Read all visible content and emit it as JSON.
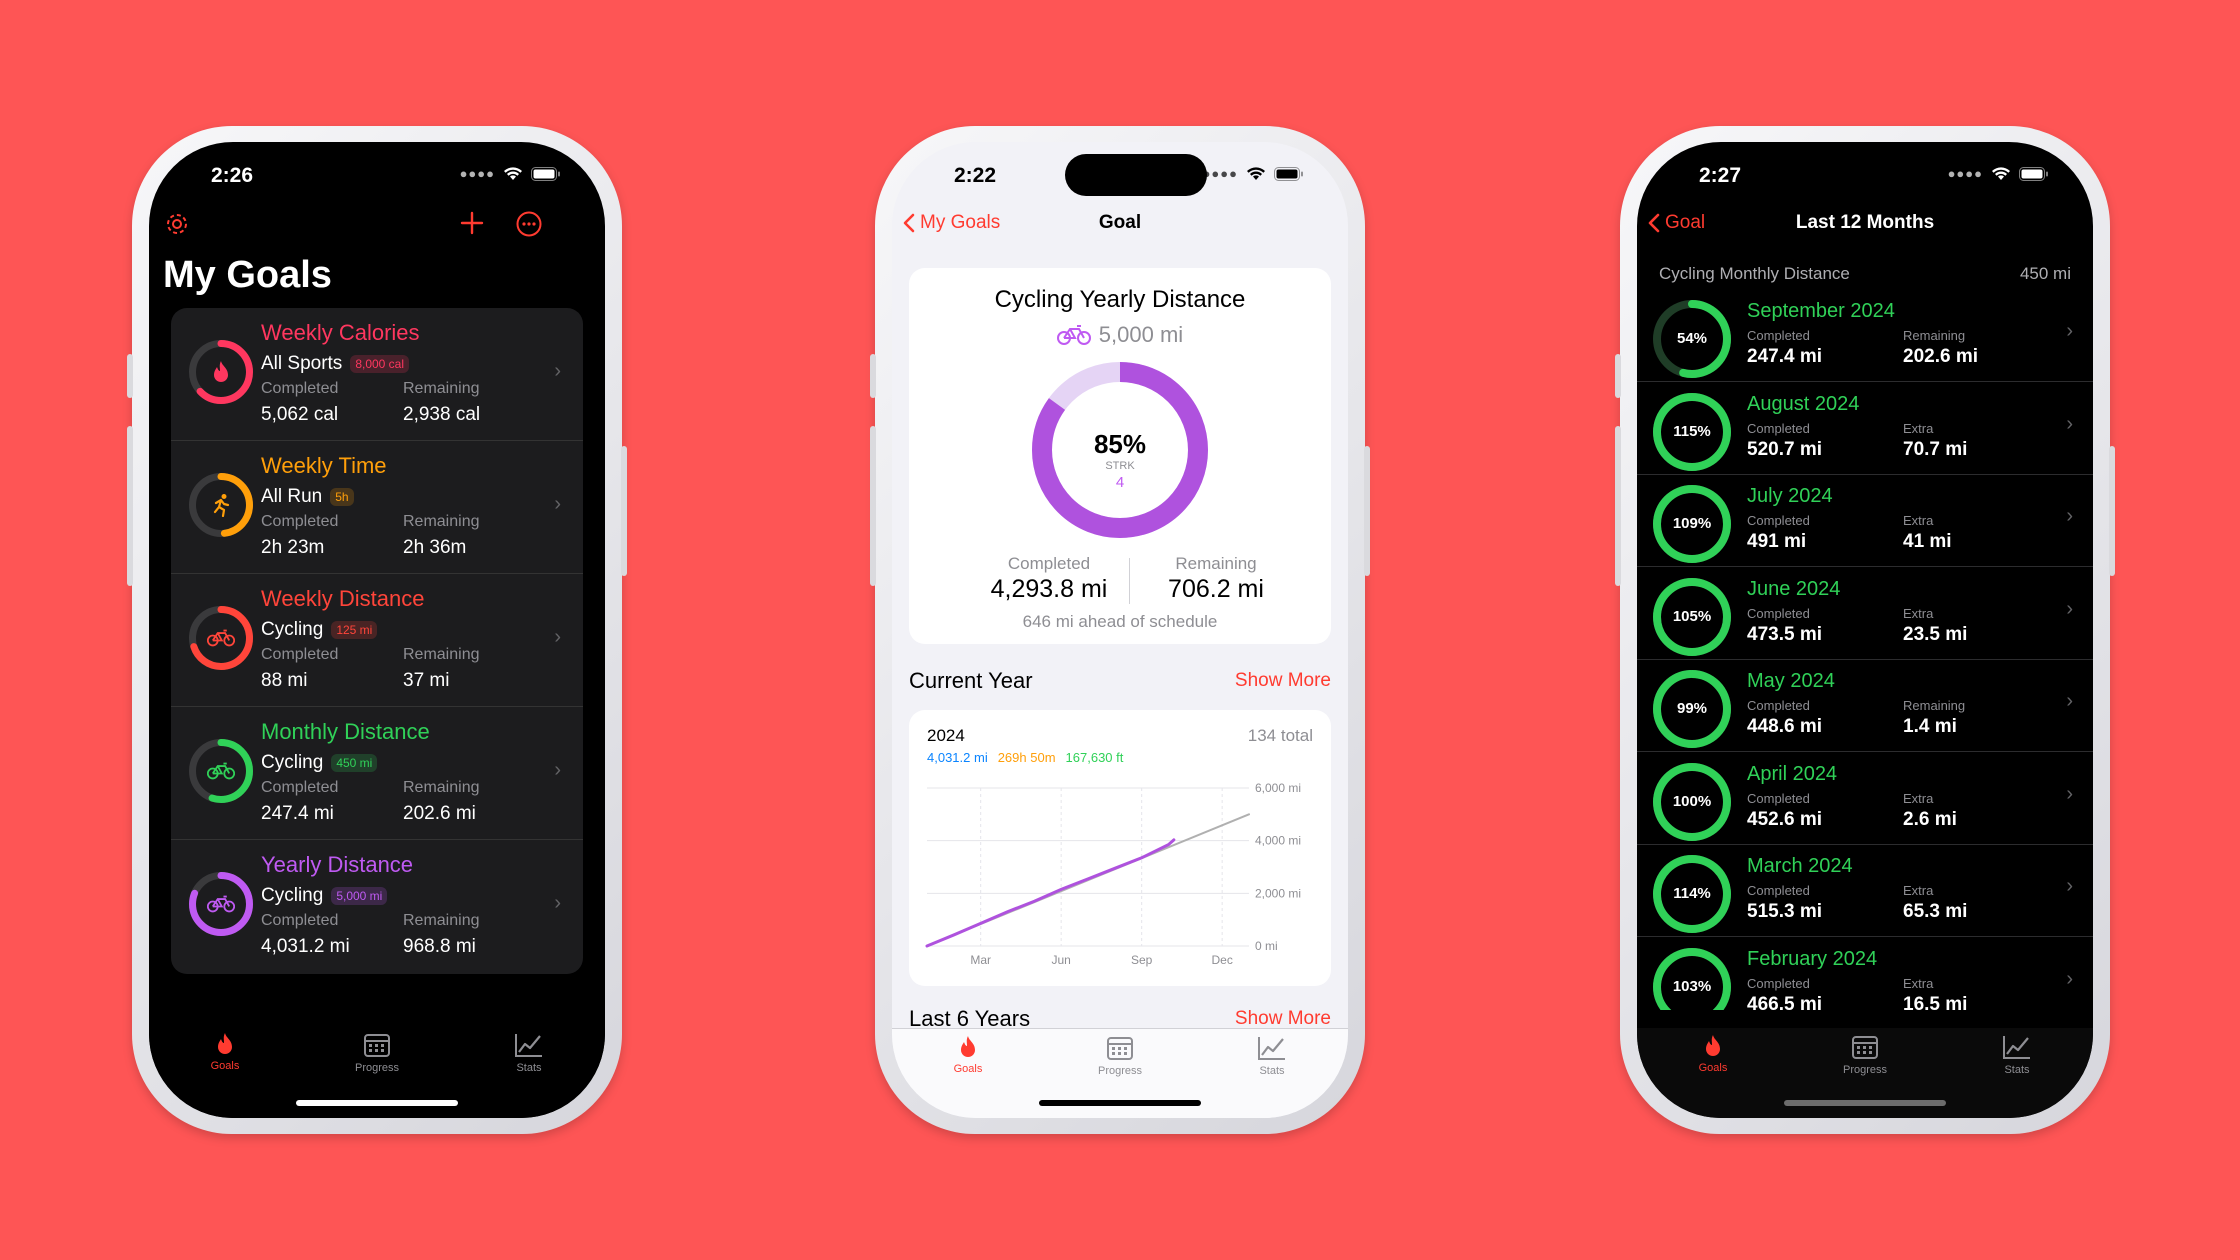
{
  "colors": {
    "accent": "#FF3B30",
    "calories": "#FF375F",
    "time": "#FF9F0A",
    "distance": "#FF453A",
    "monthly": "#30D158",
    "yearly": "#BF5AF2"
  },
  "phone1": {
    "time": "2:26",
    "title": "My Goals",
    "goals": [
      {
        "title": "Weekly Calories",
        "sport": "All Sports",
        "badge": "8,000 cal",
        "completed_label": "Completed",
        "completed": "5,062 cal",
        "remaining_label": "Remaining",
        "remaining": "2,938 cal",
        "color": "#FF375F",
        "progress": 0.63,
        "icon": "flame-icon"
      },
      {
        "title": "Weekly Time",
        "sport": "All Run",
        "badge": "5h",
        "completed_label": "Completed",
        "completed": "2h 23m",
        "remaining_label": "Remaining",
        "remaining": "2h 36m",
        "color": "#FF9F0A",
        "progress": 0.48,
        "icon": "runner-icon"
      },
      {
        "title": "Weekly Distance",
        "sport": "Cycling",
        "badge": "125 mi",
        "completed_label": "Completed",
        "completed": "88 mi",
        "remaining_label": "Remaining",
        "remaining": "37 mi",
        "color": "#FF453A",
        "progress": 0.7,
        "icon": "bicycle-icon"
      },
      {
        "title": "Monthly Distance",
        "sport": "Cycling",
        "badge": "450 mi",
        "completed_label": "Completed",
        "completed": "247.4 mi",
        "remaining_label": "Remaining",
        "remaining": "202.6 mi",
        "color": "#30D158",
        "progress": 0.55,
        "icon": "bicycle-icon"
      },
      {
        "title": "Yearly Distance",
        "sport": "Cycling",
        "badge": "5,000 mi",
        "completed_label": "Completed",
        "completed": "4,031.2 mi",
        "remaining_label": "Remaining",
        "remaining": "968.8 mi",
        "color": "#BF5AF2",
        "progress": 0.81,
        "icon": "bicycle-icon"
      }
    ]
  },
  "tabs": [
    {
      "label": "Goals",
      "icon": "flame-icon"
    },
    {
      "label": "Progress",
      "icon": "calendar-icon"
    },
    {
      "label": "Stats",
      "icon": "chart-icon"
    }
  ],
  "phone2": {
    "time": "2:22",
    "back": "My Goals",
    "nav_title": "Goal",
    "goal_title": "Cycling Yearly Distance",
    "goal_target": "5,000 mi",
    "percent": "85%",
    "progress": 0.85,
    "streak_label": "STRK",
    "streak": "4",
    "completed_label": "Completed",
    "completed": "4,293.8 mi",
    "remaining_label": "Remaining",
    "remaining": "706.2 mi",
    "schedule": "646 mi ahead of schedule",
    "current_year_label": "Current Year",
    "show_more": "Show More",
    "last6_label": "Last 6 Years",
    "chart_data": {
      "type": "line",
      "title": "2024",
      "total": "134 total",
      "legend": [
        "4,031.2 mi",
        "269h 50m",
        "167,630 ft"
      ],
      "legend_colors": [
        "#0A84FF",
        "#FF9F0A",
        "#30D158"
      ],
      "x_ticks": [
        "Mar",
        "Jun",
        "Sep",
        "Dec"
      ],
      "y_ticks": [
        "6,000 mi",
        "4,000 mi",
        "2,000 mi",
        "0 mi"
      ],
      "ylim": [
        0,
        6000
      ],
      "xlim": [
        0,
        12
      ],
      "series": [
        {
          "color": "#AF52DE",
          "x": [
            0,
            1,
            2,
            3,
            4,
            5,
            6,
            7,
            8,
            9,
            9.2
          ],
          "y": [
            0,
            420,
            860,
            1300,
            1700,
            2150,
            2550,
            2950,
            3350,
            3850,
            4031
          ]
        },
        {
          "color": "#B0B0B0",
          "x": [
            0,
            12
          ],
          "y": [
            0,
            5000
          ]
        }
      ]
    }
  },
  "phone3": {
    "time": "2:27",
    "back": "Goal",
    "nav_title": "Last 12 Months",
    "section_label": "Cycling Monthly Distance",
    "section_value": "450 mi",
    "months": [
      {
        "name": "September 2024",
        "pct": "54%",
        "progress": 0.54,
        "completed_label": "Completed",
        "completed": "247.4 mi",
        "second_label": "Remaining",
        "second": "202.6 mi"
      },
      {
        "name": "August 2024",
        "pct": "115%",
        "progress": 1.0,
        "completed_label": "Completed",
        "completed": "520.7 mi",
        "second_label": "Extra",
        "second": "70.7 mi"
      },
      {
        "name": "July 2024",
        "pct": "109%",
        "progress": 1.0,
        "completed_label": "Completed",
        "completed": "491 mi",
        "second_label": "Extra",
        "second": "41 mi"
      },
      {
        "name": "June 2024",
        "pct": "105%",
        "progress": 1.0,
        "completed_label": "Completed",
        "completed": "473.5 mi",
        "second_label": "Extra",
        "second": "23.5 mi"
      },
      {
        "name": "May 2024",
        "pct": "99%",
        "progress": 0.99,
        "completed_label": "Completed",
        "completed": "448.6 mi",
        "second_label": "Remaining",
        "second": "1.4 mi"
      },
      {
        "name": "April 2024",
        "pct": "100%",
        "progress": 1.0,
        "completed_label": "Completed",
        "completed": "452.6 mi",
        "second_label": "Extra",
        "second": "2.6 mi"
      },
      {
        "name": "March 2024",
        "pct": "114%",
        "progress": 1.0,
        "completed_label": "Completed",
        "completed": "515.3 mi",
        "second_label": "Extra",
        "second": "65.3 mi"
      },
      {
        "name": "February 2024",
        "pct": "103%",
        "progress": 1.0,
        "completed_label": "Completed",
        "completed": "466.5 mi",
        "second_label": "Extra",
        "second": "16.5 mi"
      }
    ]
  }
}
